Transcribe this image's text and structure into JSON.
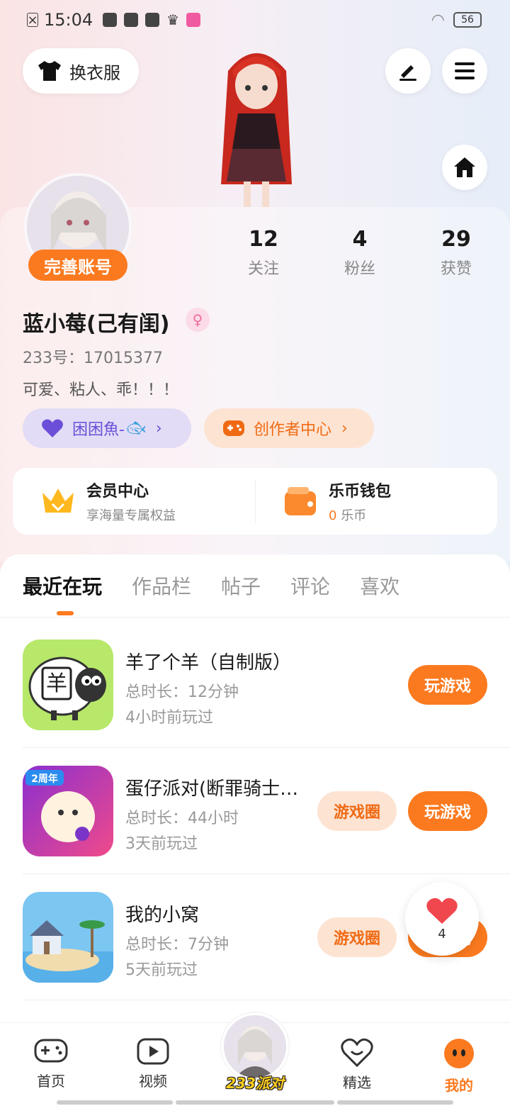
{
  "status_bar": {
    "time": "15:04",
    "battery": "56"
  },
  "header": {
    "outfit_label": "换衣服"
  },
  "profile": {
    "complete_account_label": "完善账号",
    "stats": [
      {
        "value": "12",
        "label": "关注"
      },
      {
        "value": "4",
        "label": "粉丝"
      },
      {
        "value": "29",
        "label": "获赞"
      }
    ],
    "username": "蓝小莓(己有闺)",
    "uid": "233号：17015377",
    "bio": "可爱、粘人、乖！！！",
    "pill_guild": "困困魚-",
    "pill_creator": "创作者中心"
  },
  "services": [
    {
      "title": "会员中心",
      "subtitle": "享海量专属权益"
    },
    {
      "title": "乐币钱包",
      "amount": "0",
      "unit": "乐币"
    }
  ],
  "tabs": [
    "最近在玩",
    "作品栏",
    "帖子",
    "评论",
    "喜欢"
  ],
  "games": [
    {
      "name": "羊了个羊（自制版）",
      "duration": "总时长：12分钟",
      "last_played": "4小时前玩过",
      "play_label": "玩游戏"
    },
    {
      "name": "蛋仔派对(断罪骑士联动)",
      "duration": "总时长：44小时",
      "last_played": "3天前玩过",
      "circle_label": "游戏圈",
      "play_label": "玩游戏"
    },
    {
      "name": "我的小窝",
      "duration": "总时长：7分钟",
      "last_played": "5天前玩过",
      "circle_label": "游戏圈",
      "play_label": "玩游戏"
    }
  ],
  "like_float": {
    "count": "4"
  },
  "bottom_nav": [
    {
      "label": "首页"
    },
    {
      "label": "视频"
    },
    {
      "label": "233派对"
    },
    {
      "label": "精选"
    },
    {
      "label": "我的"
    }
  ],
  "colors": {
    "accent": "#fb7a1f",
    "purple": "#6b4fd8"
  }
}
